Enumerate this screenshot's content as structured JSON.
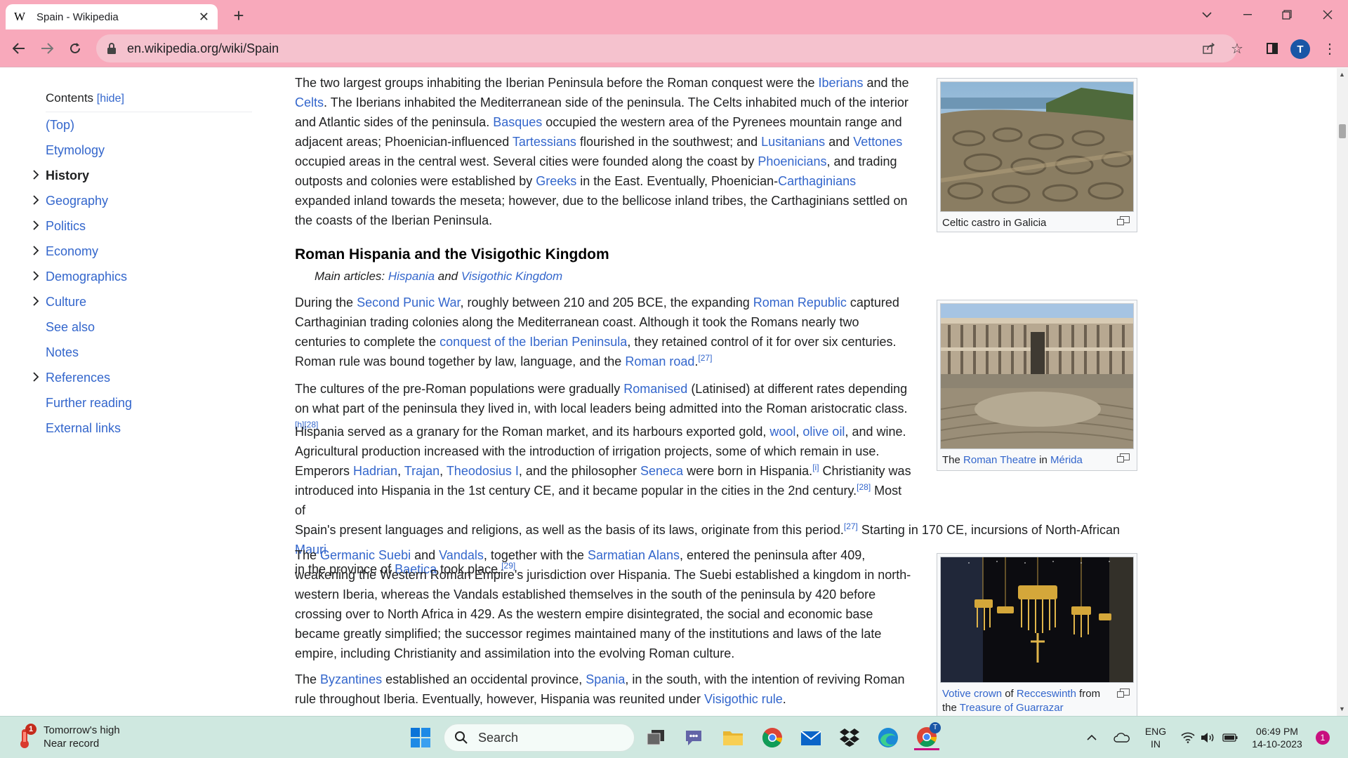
{
  "browser": {
    "tab_title": "Spain - Wikipedia",
    "tab_favicon": "W",
    "url": "en.wikipedia.org/wiki/Spain",
    "profile_initial": "T"
  },
  "toc": {
    "heading": "Contents",
    "hide_label": "[hide]",
    "items": [
      {
        "label": "(Top)",
        "expandable": false,
        "active": false
      },
      {
        "label": "Etymology",
        "expandable": false,
        "active": false
      },
      {
        "label": "History",
        "expandable": true,
        "active": true
      },
      {
        "label": "Geography",
        "expandable": true,
        "active": false
      },
      {
        "label": "Politics",
        "expandable": true,
        "active": false
      },
      {
        "label": "Economy",
        "expandable": true,
        "active": false
      },
      {
        "label": "Demographics",
        "expandable": true,
        "active": false
      },
      {
        "label": "Culture",
        "expandable": true,
        "active": false
      },
      {
        "label": "See also",
        "expandable": false,
        "active": false
      },
      {
        "label": "Notes",
        "expandable": false,
        "active": false
      },
      {
        "label": "References",
        "expandable": true,
        "active": false
      },
      {
        "label": "Further reading",
        "expandable": false,
        "active": false
      },
      {
        "label": "External links",
        "expandable": false,
        "active": false
      }
    ]
  },
  "article": {
    "section_heading": "Roman Hispania and the Visigothic Kingdom",
    "hatnote_prefix": "Main articles:",
    "hatnote_link1": "Hispania",
    "hatnote_and": "and",
    "hatnote_link2": "Visigothic Kingdom",
    "figures": [
      {
        "caption": "Celtic castro in Galicia"
      },
      {
        "caption_pre": "The ",
        "caption_link1": "Roman Theatre",
        "caption_mid": " in ",
        "caption_link2": "Mérida"
      },
      {
        "caption_link1": "Votive crown",
        "caption_mid": " of ",
        "caption_link2": "Recceswinth",
        "caption_mid2": " from the ",
        "caption_link3": "Treasure of Guarrazar"
      }
    ]
  },
  "taskbar": {
    "weather_title": "Tomorrow's high",
    "weather_sub": "Near record",
    "weather_badge": "1",
    "search_label": "Search",
    "lang_top": "ENG",
    "lang_bottom": "IN",
    "time": "06:49 PM",
    "date": "14-10-2023",
    "notification_count": "1",
    "chrome_badge": "T"
  }
}
